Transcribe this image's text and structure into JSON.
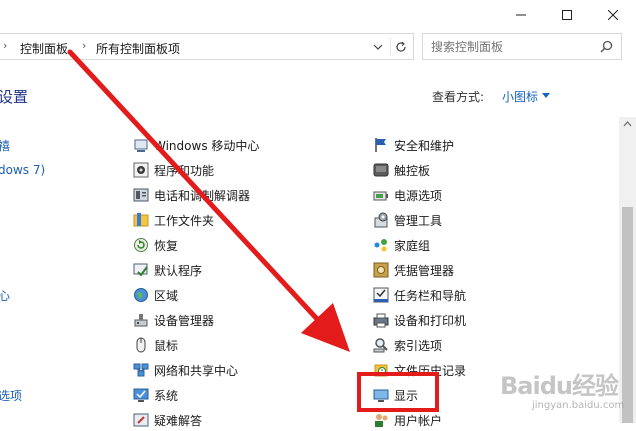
{
  "breadcrumb": {
    "item1": "控制面板",
    "item2": "所有控制面板项"
  },
  "search": {
    "placeholder": "搜索控制面板"
  },
  "header": {
    "title": "设置",
    "view_by_label": "查看方式:",
    "view_by_value": "小图标"
  },
  "columns": {
    "col0": [
      "禧",
      "dows 7)",
      "心",
      "选项"
    ],
    "col1": [
      "Windows 移动中心",
      "程序和功能",
      "电话和调制解调器",
      "工作文件夹",
      "恢复",
      "默认程序",
      "区域",
      "设备管理器",
      "鼠标",
      "网络和共享中心",
      "系统",
      "疑难解答"
    ],
    "col2": [
      "安全和维护",
      "触控板",
      "电源选项",
      "管理工具",
      "家庭组",
      "凭据管理器",
      "任务栏和导航",
      "设备和打印机",
      "索引选项",
      "文件历史记录",
      "显示",
      "用户帐户"
    ]
  },
  "icons": {
    "col1": [
      "mobility-center-icon",
      "programs-features-icon",
      "phone-modem-icon",
      "work-folders-icon",
      "recovery-icon",
      "default-programs-icon",
      "region-icon",
      "device-manager-icon",
      "mouse-icon",
      "network-sharing-icon",
      "system-icon",
      "troubleshooting-icon"
    ],
    "col2": [
      "security-maintenance-icon",
      "touchpad-icon",
      "power-options-icon",
      "admin-tools-icon",
      "homegroup-icon",
      "credential-manager-icon",
      "taskbar-navigation-icon",
      "devices-printers-icon",
      "indexing-options-icon",
      "file-history-icon",
      "display-icon",
      "user-accounts-icon"
    ]
  },
  "watermark": {
    "brand": "Baidu经验",
    "url": "jingyan.baidu.com"
  },
  "colors": {
    "link": "#1a5fb4",
    "title": "#1e3287",
    "annotation": "#e31b1b"
  }
}
